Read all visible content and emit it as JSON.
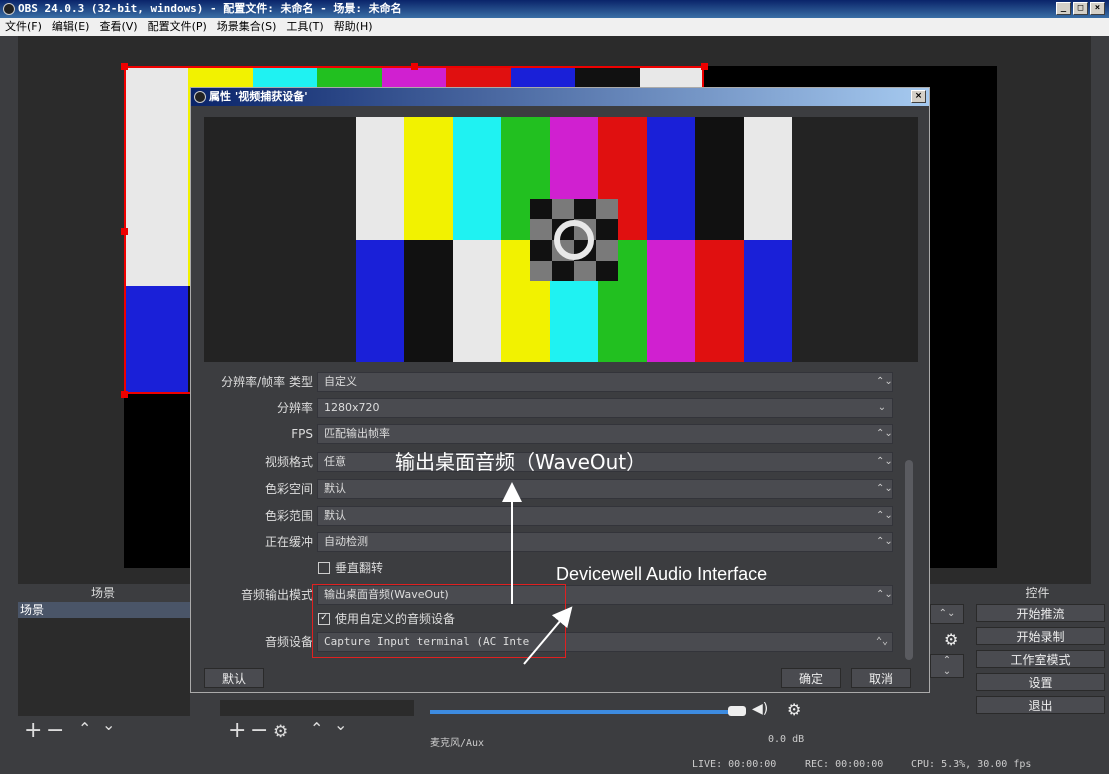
{
  "window": {
    "title": "OBS 24.0.3 (32-bit, windows) - 配置文件: 未命名 - 场景: 未命名",
    "min": "_",
    "max": "□",
    "close": "×"
  },
  "menu": [
    "文件(F)",
    "编辑(E)",
    "查看(V)",
    "配置文件(P)",
    "场景集合(S)",
    "工具(T)",
    "帮助(H)"
  ],
  "color_bars": {
    "top": [
      "#e8e8e8",
      "#f2f200",
      "#1ff2f2",
      "#22c020",
      "#d020d0",
      "#e01010",
      "#1a20d8",
      "#111111",
      "#e8e8e8"
    ],
    "mid": [
      "#1a20d8",
      "#111111",
      "#e8e8e8",
      "#f2f200",
      "#1ff2f2",
      "#22c020",
      "#d020d0",
      "#e01010",
      "#1a20d8"
    ],
    "selection": "#e00000"
  },
  "docks": {
    "scenes_title": "场景",
    "scenes_item": "场景",
    "controls_title": "控件",
    "mixer_track": "麦克风/Aux",
    "mixer_db": "0.0 dB"
  },
  "controls": {
    "start_stream": "开始推流",
    "start_record": "开始录制",
    "studio_mode": "工作室模式",
    "settings": "设置",
    "exit": "退出"
  },
  "status": {
    "live": "LIVE: 00:00:00",
    "rec": "REC: 00:00:00",
    "cpu": "CPU: 5.3%, 30.00 fps"
  },
  "dialog": {
    "title": "属性 '视频捕获设备'",
    "close": "×",
    "rows": [
      {
        "label": "分辨率/帧率 类型",
        "value": "自定义",
        "arrow": "⌃⌄"
      },
      {
        "label": "分辨率",
        "value": "1280x720",
        "arrow": "⌄"
      },
      {
        "label": "FPS",
        "value": "匹配输出帧率",
        "arrow": "⌃⌄"
      },
      {
        "label": "视频格式",
        "value": "任意",
        "arrow": "⌃⌄"
      },
      {
        "label": "色彩空间",
        "value": "默认",
        "arrow": "⌃⌄"
      },
      {
        "label": "色彩范围",
        "value": "默认",
        "arrow": "⌃⌄"
      },
      {
        "label": "正在缓冲",
        "value": "自动检测",
        "arrow": "⌃⌄"
      }
    ],
    "flip_label": "垂直翻转",
    "audio_mode_label": "音频输出模式",
    "audio_mode_value": "输出桌面音频(WaveOut)",
    "custom_audio_label": "使用自定义的音频设备",
    "audio_device_label": "音频设备",
    "audio_device_value": "Capture Input terminal (AC Inte",
    "defaults_button": "默认",
    "ok_button": "确定",
    "cancel_button": "取消"
  },
  "annotations": {
    "mode_note": "输出桌面音频（WaveOut）",
    "device_note": "Devicewell Audio Interface"
  }
}
